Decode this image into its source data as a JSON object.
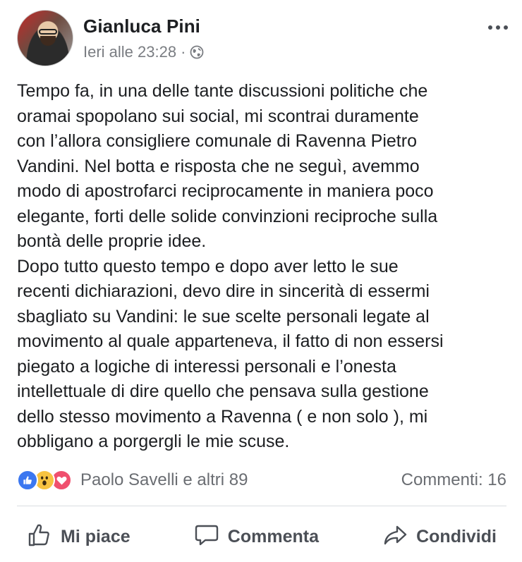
{
  "post": {
    "author_name": "Gianluca Pini",
    "timestamp": "Ieri alle 23:28",
    "separator": "·",
    "audience_icon": "globe-icon",
    "text": "Tempo fa, in una delle tante discussioni politiche che\noramai spopolano sui social, mi scontrai duramente\ncon l’allora consigliere comunale di Ravenna Pietro\nVandini. Nel botta e risposta che ne seguì, avemmo\nmodo di apostrofarci reciprocamente in maniera poco\nelegante, forti delle solide convinzioni reciproche sulla\nbontà delle proprie idee.\nDopo tutto questo tempo e dopo aver letto le sue\nrecenti dichiarazioni, devo dire in sincerità di essermi\nsbagliato su Vandini: le sue scelte personali legate al\nmovimento al quale apparteneva, il fatto di non essersi\npiegato a logiche di interessi personali e l’onesta\nintellettuale di dire quello che pensava sulla gestione\ndello stesso movimento a Ravenna ( e non solo ), mi\nobbligano a porgergli le mie scuse."
  },
  "reactions": {
    "icons": [
      "like-icon",
      "wow-icon",
      "love-icon"
    ],
    "label": "Paolo Savelli e altri 89",
    "comments_label": "Commenti: 16"
  },
  "actions": {
    "like_label": "Mi piace",
    "comment_label": "Commenta",
    "share_label": "Condividi"
  },
  "colors": {
    "like_blue": "#3b77f0",
    "wow_yellow": "#f7c341",
    "love_red": "#f0506e",
    "text": "#1c1e21",
    "secondary_text": "#6a6d72"
  }
}
